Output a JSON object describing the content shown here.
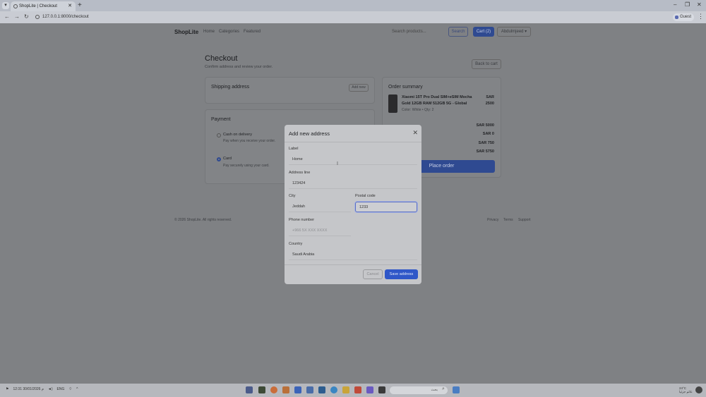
{
  "browser": {
    "tab_title": "ShopLite | Checkout",
    "url": "127.0.0.1:8000/checkout",
    "profile": "Guest"
  },
  "nav": {
    "brand": "ShopLite",
    "links": [
      "Home",
      "Categories",
      "Featured"
    ],
    "search_placeholder": "Search products...",
    "search_button": "Search",
    "cart_button": "Cart (2)",
    "user_menu": "Abdulmjeed"
  },
  "checkout": {
    "title": "Checkout",
    "subtitle": "Confirm address and review your order.",
    "back_button": "Back to cart",
    "shipping": {
      "title": "Shipping address",
      "add_new": "Add new"
    },
    "payment": {
      "title": "Payment",
      "options": [
        {
          "label": "Cash on delivery",
          "desc": "Pay when you receive your order."
        },
        {
          "label": "Card",
          "desc": "Pay securely using your card."
        }
      ],
      "selected": "Card"
    }
  },
  "summary": {
    "title": "Order summary",
    "item": {
      "name_line1": "Xiaomi 15T Pro Dual SIM+eSIM Mocha",
      "name_line2": "Gold 12GB RAM 512GB 5G - Global",
      "meta": "Color: White • Qty: 2",
      "price_cur": "SAR",
      "price_val": "2500"
    },
    "rows": [
      "SAR 5000",
      "SAR 0",
      "SAR 750",
      "SAR 5750"
    ],
    "place_order": "Place order"
  },
  "footer": {
    "copyright": "© 2026 ShopLite. All rights reserved.",
    "links": [
      "Privacy",
      "Terms",
      "Support"
    ]
  },
  "modal": {
    "title": "Add new address",
    "fields": {
      "label": {
        "label": "Label",
        "value": "Home"
      },
      "address": {
        "label": "Address line",
        "value": "123424"
      },
      "city": {
        "label": "City",
        "value": "Jeddah"
      },
      "postal": {
        "label": "Postal code",
        "value": "1233"
      },
      "phone": {
        "label": "Phone number",
        "placeholder": "+966 5X XXX XXXX"
      },
      "country": {
        "label": "Country",
        "value": "Saudi Arabia"
      }
    },
    "cancel": "Cancel",
    "save": "Save address"
  },
  "taskbar": {
    "time": "12:31 م",
    "date": "30/01/2026",
    "lang": "ENG",
    "search_placeholder": "بحث",
    "weather_temp": "24°C",
    "weather_desc": "غائم جزئيا"
  },
  "colors": {
    "accent": "#2f57c8",
    "overlay": "#808285"
  }
}
